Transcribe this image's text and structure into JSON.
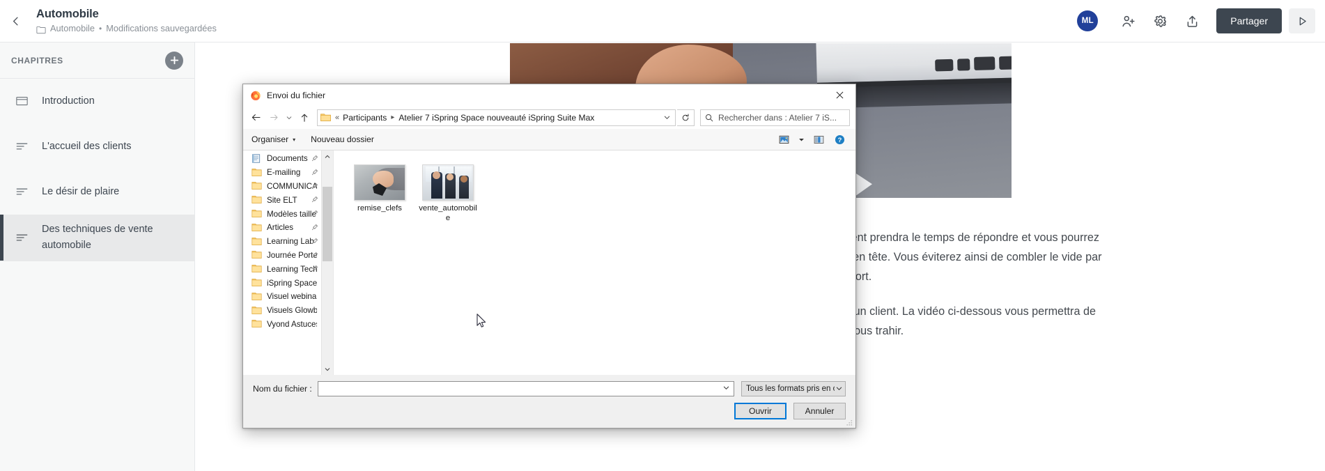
{
  "app": {
    "back_icon": "chevron-left-icon",
    "title": "Automobile",
    "breadcrumb_folder_icon": "folder-icon",
    "breadcrumb_folder": "Automobile",
    "breadcrumb_separator": "•",
    "breadcrumb_status": "Modifications sauvegardées",
    "toolbar": {
      "avatar_initials": "ML",
      "avatar_color": "#21409a",
      "invite_icon": "add-person-icon",
      "settings_icon": "gear-icon",
      "share_icon": "share-upload-icon",
      "share_label": "Partager",
      "share_bg": "#3d4650",
      "preview_icon": "play-triangle-icon"
    }
  },
  "sidebar": {
    "heading": "CHAPITRES",
    "add_icon": "plus-circle-icon",
    "items": [
      {
        "label": "Introduction",
        "icon": "slide-icon",
        "active": false
      },
      {
        "label": "L'accueil des clients",
        "icon": "lines-icon",
        "active": false
      },
      {
        "label": "Le désir de plaire",
        "icon": "lines-icon",
        "active": false
      },
      {
        "label": "Des techniques de vente automobile",
        "icon": "lines-icon",
        "active": true
      }
    ]
  },
  "content": {
    "hero_image_alt": "hands-with-paper-and-laptop-photo",
    "paragraphs": [
      "Si vous posez une question, laissez un silence. Le client prendra le temps de répondre et vous pourrez ainsi mieux cerner ses besoins. Le silence deviendra en tête. Vous éviterez ainsi de combler le vide par des paroles qui pourraient laisser paraître votre inconfort.",
      "Le non verbal est un élément déterminant aux yeux d'un client. La vidéo ci-dessous vous permettra de comprendre comment notre corps très souvent peut nous trahir."
    ]
  },
  "file_dialog": {
    "app_icon": "firefox-icon",
    "title": "Envoi du fichier",
    "close_icon": "close-icon",
    "nav": {
      "back_icon": "arrow-left-icon",
      "forward_icon": "arrow-right-icon",
      "recent_icon": "chevron-down-icon",
      "up_icon": "arrow-up-icon",
      "address_folder_icon": "folder-icon",
      "address_overflow": "«",
      "breadcrumbs": [
        "Participants",
        "Atelier 7 iSpring Space nouveauté iSpring Suite Max"
      ],
      "address_dropdown_icon": "chevron-down-icon",
      "refresh_icon": "refresh-icon",
      "search_icon": "search-icon",
      "search_placeholder": "Rechercher dans : Atelier 7 iS..."
    },
    "toolbar": {
      "organise_label": "Organiser",
      "organise_caret": "▾",
      "new_folder_label": "Nouveau dossier",
      "view_icon": "view-mode-icon",
      "view_caret": "▾",
      "pane_icon": "preview-pane-icon",
      "help_icon": "help-circle-icon"
    },
    "tree": {
      "scroll_up_icon": "chevron-up-icon",
      "scroll_down_icon": "chevron-down-icon",
      "items": [
        {
          "label": "Documents",
          "icon": "documents-icon",
          "pinned": true
        },
        {
          "label": "E-mailing",
          "icon": "folder-icon",
          "pinned": true
        },
        {
          "label": "COMMUNICA",
          "icon": "folder-icon",
          "pinned": true
        },
        {
          "label": "Site ELT",
          "icon": "folder-icon",
          "pinned": true
        },
        {
          "label": "Modèles taille",
          "icon": "folder-icon",
          "pinned": true
        },
        {
          "label": "Articles",
          "icon": "folder-icon",
          "pinned": true
        },
        {
          "label": "Learning Lab",
          "icon": "folder-icon",
          "pinned": true
        },
        {
          "label": "Journée Porte",
          "icon": "folder-icon",
          "pinned": true
        },
        {
          "label": "Learning Tech",
          "icon": "folder-icon",
          "pinned": true
        },
        {
          "label": "iSpring Space  C",
          "icon": "folder-icon",
          "pinned": false
        },
        {
          "label": "Visuel webinars i",
          "icon": "folder-icon",
          "pinned": false
        },
        {
          "label": "Visuels Glowbl -",
          "icon": "folder-icon",
          "pinned": false
        },
        {
          "label": "Vyond  Astuces ",
          "icon": "folder-icon",
          "pinned": false
        }
      ]
    },
    "files": [
      {
        "name": "remise_clefs",
        "thumb": "car-keys-photo"
      },
      {
        "name": "vente_automobile",
        "thumb": "dealership-people-photo"
      }
    ],
    "footer": {
      "filename_label": "Nom du fichier :",
      "filename_value": "",
      "filename_dropdown_icon": "chevron-down-icon",
      "filter_value": "Tous les formats pris en charge",
      "filter_caret": "▾",
      "open_label": "Ouvrir",
      "cancel_label": "Annuler",
      "resize_grip_icon": "resize-grip-icon"
    }
  },
  "cursor": {
    "icon": "mouse-pointer-icon"
  }
}
